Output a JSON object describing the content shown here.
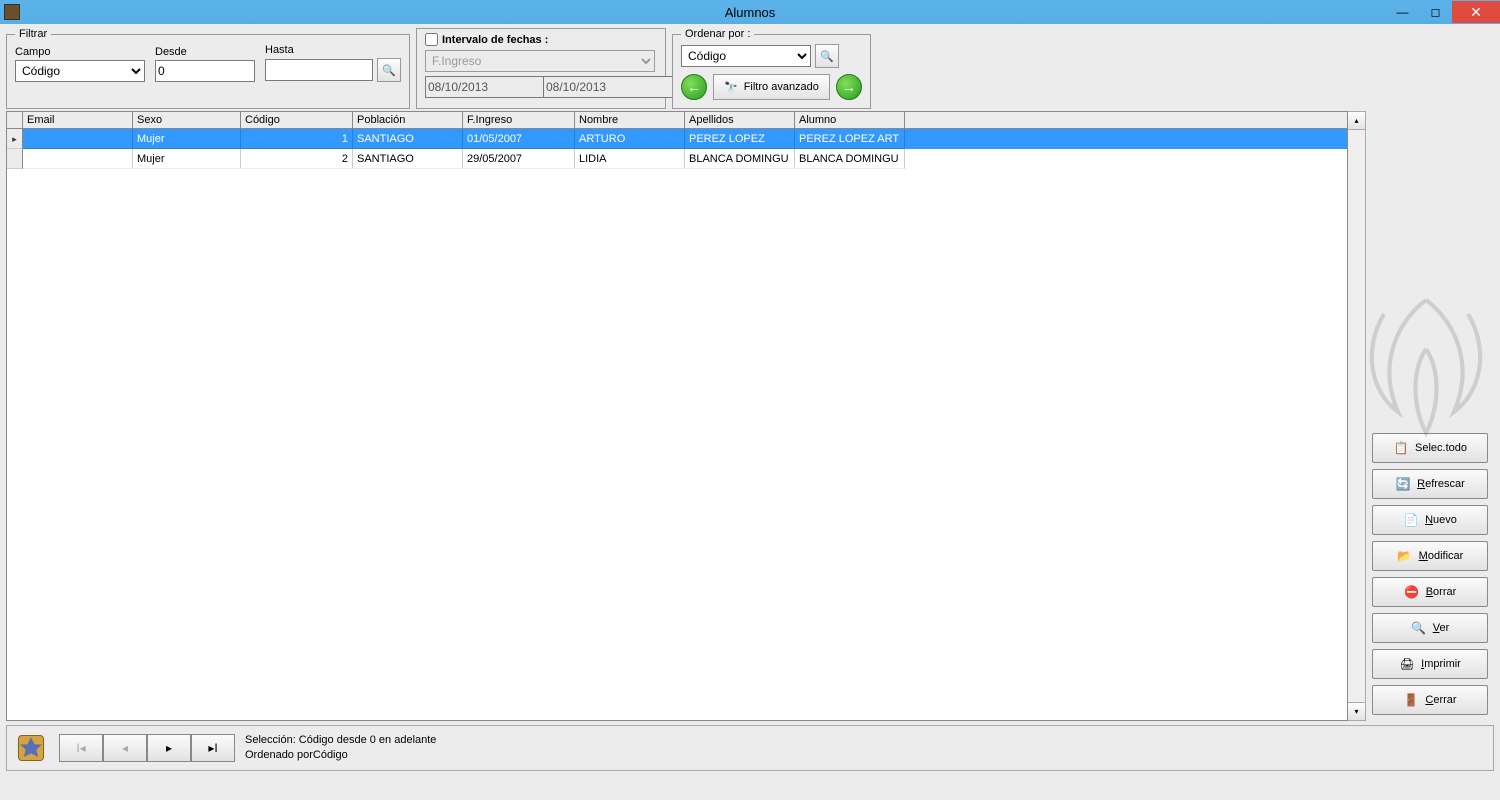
{
  "window": {
    "title": "Alumnos"
  },
  "filter": {
    "legend": "Filtrar",
    "campo_label": "Campo",
    "campo_value": "Código",
    "desde_label": "Desde",
    "desde_value": "0",
    "hasta_label": "Hasta",
    "hasta_value": ""
  },
  "date_interval": {
    "checkbox_label": "Intervalo de fechas :",
    "field_value": "F.Ingreso",
    "date_from": "08/10/2013",
    "date_to": "08/10/2013"
  },
  "order": {
    "legend": "Ordenar por :",
    "value": "Código",
    "filter_adv_label": "Filtro avanzado"
  },
  "grid": {
    "columns": [
      "Email",
      "Sexo",
      "Código",
      "Población",
      "F.Ingreso",
      "Nombre",
      "Apellidos",
      "Alumno"
    ],
    "rows": [
      {
        "email": "",
        "sexo": "Mujer",
        "codigo": "1",
        "poblacion": "SANTIAGO",
        "fingreso": "01/05/2007",
        "nombre": "ARTURO",
        "apellidos": "PEREZ LOPEZ",
        "alumno": "PEREZ LOPEZ ART",
        "selected": true
      },
      {
        "email": "",
        "sexo": "Mujer",
        "codigo": "2",
        "poblacion": "SANTIAGO",
        "fingreso": "29/05/2007",
        "nombre": "LIDIA",
        "apellidos": "BLANCA DOMINGU",
        "alumno": "BLANCA DOMINGU",
        "selected": false
      }
    ]
  },
  "actions": {
    "select_all": "Selec.todo",
    "refresh": "Refrescar",
    "new": "Nuevo",
    "modify": "Modificar",
    "delete": "Borrar",
    "view": "Ver",
    "print": "Imprimir",
    "close": "Cerrar"
  },
  "status": {
    "line1": "Selección: Código desde 0 en adelante",
    "line2": "Ordenado porCódigo"
  }
}
